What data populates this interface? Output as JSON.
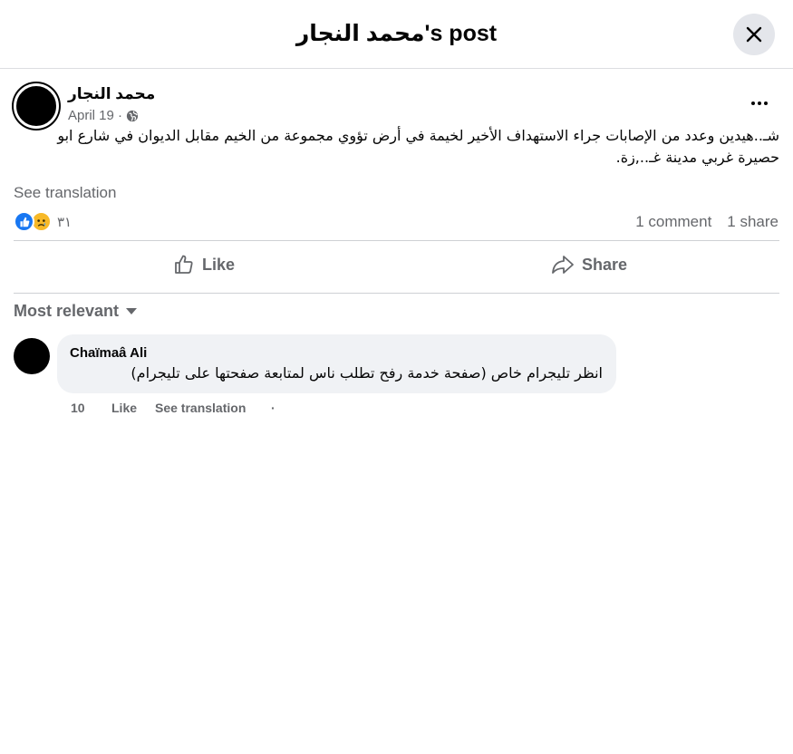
{
  "header": {
    "title": "محمد النجار's post"
  },
  "post": {
    "author": "محمد النجار",
    "date": "April 19 ·",
    "audience_icon": "globe-icon",
    "text": "شـ..هيدين وعدد من الإصابات جراء الاستهداف الأخير لخيمة في أرض تؤوي مجموعة من الخيم مقابل الديوان في شارع ابو حصيرة غربي مدينة غـ..,زة.",
    "see_translation": "See translation",
    "reaction_count": "٣١",
    "comments": "1 comment",
    "shares": "1 share"
  },
  "actions": {
    "like": "Like",
    "share": "Share"
  },
  "sort": {
    "label": "Most relevant"
  },
  "comment": {
    "author": "Chaïmaâ Ali",
    "text": "انظر تليجرام خاص (صفحة خدمة رفح تطلب ناس لمتابعة صفحتها على تليجرام)",
    "age": "10",
    "like": "Like",
    "see_translation": "See translation",
    "separator": "·"
  },
  "colors": {
    "like_blue": "#1877f2",
    "sad_yellow": "#f7b928",
    "secondary_text": "#65676b",
    "bubble_bg": "#f0f2f5"
  }
}
